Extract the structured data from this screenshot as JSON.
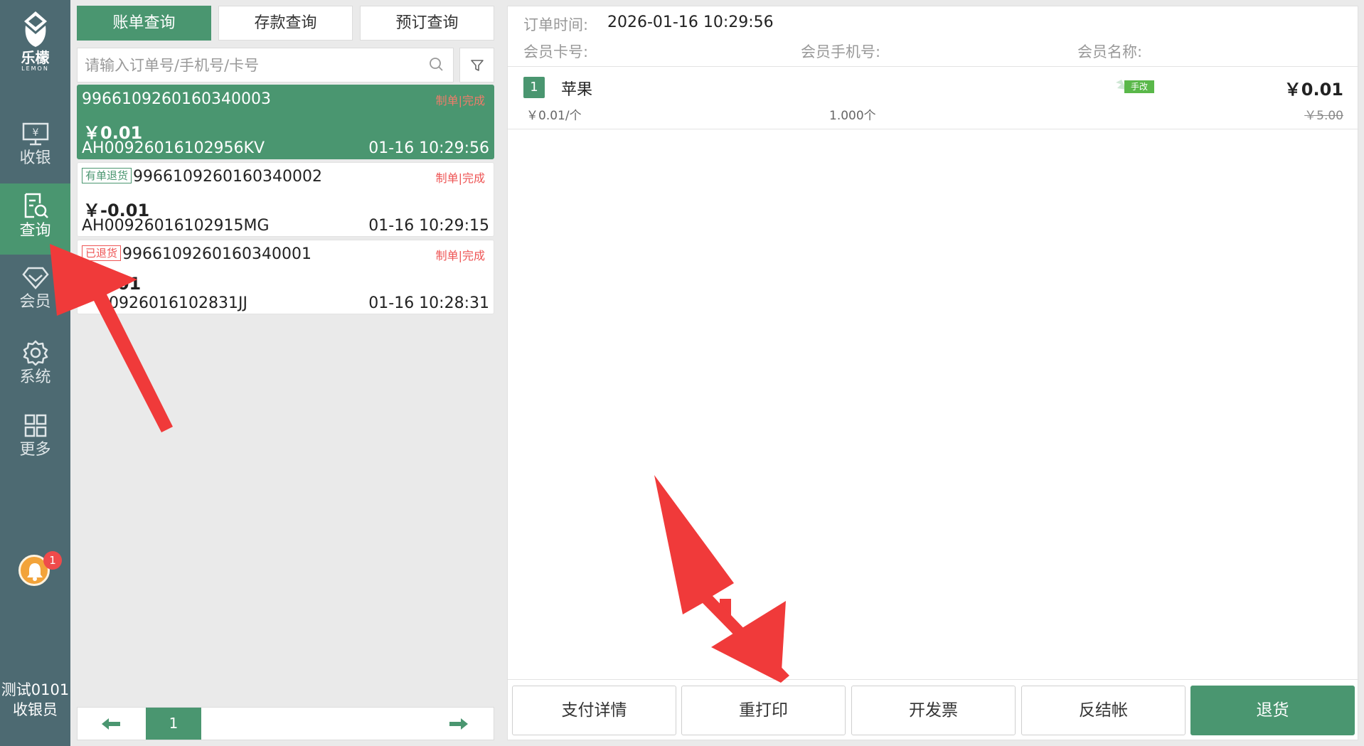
{
  "app": {
    "logo_cn": "乐檬",
    "logo_en": "LEMON"
  },
  "sidebar": {
    "items": [
      {
        "label": "收银",
        "icon": "cash-register-icon"
      },
      {
        "label": "查询",
        "icon": "query-icon",
        "active": true
      },
      {
        "label": "会员",
        "icon": "diamond-icon"
      },
      {
        "label": "系统",
        "icon": "gear-icon"
      },
      {
        "label": "更多",
        "icon": "grid-icon"
      }
    ],
    "notification_count": "1",
    "user_name": "测试0101",
    "user_role": "收银员"
  },
  "tabs": [
    {
      "label": "账单查询",
      "active": true
    },
    {
      "label": "存款查询"
    },
    {
      "label": "预订查询"
    }
  ],
  "search": {
    "placeholder": "请输入订单号/手机号/卡号"
  },
  "orders": [
    {
      "badge": "",
      "order_no": "9966109260160340003",
      "status": "制单|完成",
      "amount": "￥0.01",
      "code": "AH00926016102956KV",
      "time": "01-16 10:29:56",
      "selected": true
    },
    {
      "badge": "有单退货",
      "order_no": "9966109260160340002",
      "status": "制单|完成",
      "amount": "￥-0.01",
      "code": "AH00926016102915MG",
      "time": "01-16 10:29:15"
    },
    {
      "badge": "已退货",
      "order_no": "9966109260160340001",
      "status": "制单|完成",
      "amount": "0.01",
      "code": "00926016102831JJ",
      "time": "01-16 10:28:31"
    }
  ],
  "pager": {
    "current_page": "1"
  },
  "detail": {
    "order_time_label": "订单时间:",
    "order_time_value": "2026-01-16 10:29:56",
    "member_card_label": "会员卡号:",
    "member_phone_label": "会员手机号:",
    "member_name_label": "会员名称:",
    "items": [
      {
        "index": "1",
        "name": "苹果",
        "tag": "手改",
        "total": "￥0.01",
        "unit_price": "￥0.01/个",
        "qty": "1.000个",
        "orig_price": "￥5.00"
      }
    ]
  },
  "actions": {
    "pay_detail": "支付详情",
    "reprint": "重打印",
    "invoice": "开发票",
    "reverse_checkout": "反结帐",
    "return_goods": "退货"
  },
  "colors": {
    "sidebar_bg": "#4d6a72",
    "accent_green": "#4a9670",
    "status_red": "#e55555",
    "annotation_red": "#f03a3a"
  }
}
